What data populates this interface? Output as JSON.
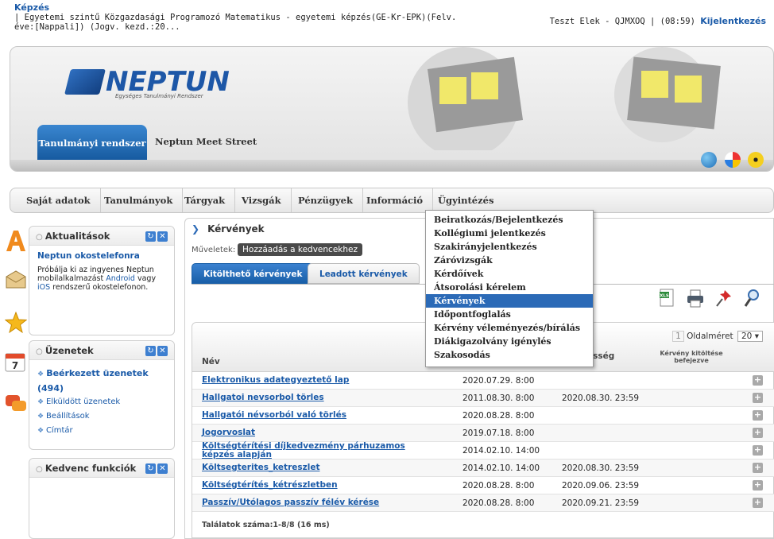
{
  "header": {
    "breadcrumb_link": "Képzés",
    "training_info": "| Egyetemi szintű Közgazdasági Programozó Matematikus - egyetemi képzés(GE-Kr-EPK)(Felv. éve:[Nappali]) (Jogv. kezd.:20...",
    "user": "Teszt Elek - QJMXOQ",
    "separator": "|",
    "timer": "(08:59)",
    "logout": "Kijelentkezés"
  },
  "banner": {
    "logo_text": "NEPTUN",
    "logo_subtitle": "Egységes Tanulmányi Rendszer",
    "tab_active": "Tanulmányi rendszer",
    "tab_other": "Neptun Meet Street"
  },
  "menu": {
    "items": [
      "Saját adatok",
      "Tanulmányok",
      "Tárgyak",
      "Vizsgák",
      "Pénzügyek",
      "Információ",
      "Ügyintézés"
    ]
  },
  "dropdown": {
    "items": [
      "Beiratkozás/Bejelentkezés",
      "Kollégiumi jelentkezés",
      "Szakirányjelentkezés",
      "Záróvizsgák",
      "Kérdőívek",
      "Átsorolási kérelem",
      "Kérvények",
      "Időpontfoglalás",
      "Kérvény véleményezés/bírálás",
      "Diákigazolvány igénylés",
      "Szakosodás"
    ],
    "active_index": 6
  },
  "widgets": {
    "news": {
      "title": "Aktualitások",
      "headline": "Neptun okostelefonra",
      "body_1": "Próbálja ki az ingyenes Neptun mobilalkalmazást ",
      "link_android": "Android",
      "body_2": " vagy ",
      "link_ios": "iOS",
      "body_3": " rendszerű okostelefonon."
    },
    "messages": {
      "title": "Üzenetek",
      "items": [
        "Beérkezett üzenetek (494)",
        "Elküldött üzenetek",
        "Beállítások",
        "Címtár"
      ]
    },
    "favorites": {
      "title": "Kedvenc funkciók"
    }
  },
  "main": {
    "title": "Kérvények",
    "actions_label": "Műveletek:",
    "favorite_button": "Hozzáadás a kedvencekhez",
    "tabs": [
      "Kitölthető kérvények",
      "Leadott kérvények"
    ],
    "pager": {
      "page": "1",
      "label": "Oldalméret",
      "size": "20"
    },
    "columns": {
      "name": "Név",
      "validity": "esség",
      "completed": "Kérvény kitöltése befejezve"
    },
    "rows": [
      {
        "name": "Elektronikus adategyeztető lap",
        "from": "2020.07.29. 8:00",
        "to": ""
      },
      {
        "name": "Hallgatoi nevsorbol törles",
        "from": "2011.08.30. 8:00",
        "to": "2020.08.30. 23:59"
      },
      {
        "name": "Hallgatói névsorból való törlés",
        "from": "2020.08.28. 8:00",
        "to": ""
      },
      {
        "name": "Jogorvoslat",
        "from": "2019.07.18. 8:00",
        "to": ""
      },
      {
        "name": "Költségtérítési díjkedvezmény párhuzamos képzés alapján",
        "from": "2014.02.10. 14:00",
        "to": ""
      },
      {
        "name": "Költsegterites_ketreszlet",
        "from": "2014.02.10. 14:00",
        "to": "2020.08.30. 23:59"
      },
      {
        "name": "Költségtérítés_kétrészletben",
        "from": "2020.08.28. 8:00",
        "to": "2020.09.06. 23:59"
      },
      {
        "name": "Passzív/Utólagos passzív félév kérése",
        "from": "2020.08.28. 8:00",
        "to": "2020.09.21. 23:59"
      }
    ],
    "found": "Találatok száma:1-8/8 (16 ms)"
  },
  "colors": {
    "accent": "#2b6ab7",
    "link": "#1a5aa8"
  }
}
